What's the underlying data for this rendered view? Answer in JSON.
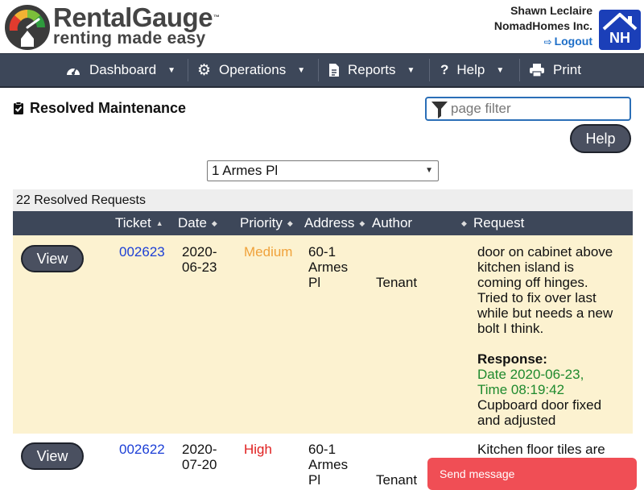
{
  "header": {
    "brand": "RentalGauge",
    "trademark": "™",
    "tagline": "renting made easy",
    "user_name": "Shawn Leclaire",
    "company": "NomadHomes Inc.",
    "logout_label": "Logout",
    "company_badge": "NH"
  },
  "nav": {
    "items": [
      {
        "label": "Dashboard",
        "icon": "dashboard-gauge-icon",
        "has_caret": true
      },
      {
        "label": "Operations",
        "icon": "gear-icon",
        "has_caret": true
      },
      {
        "label": "Reports",
        "icon": "document-icon",
        "has_caret": true
      },
      {
        "label": "Help",
        "icon": "question-icon",
        "has_caret": true
      },
      {
        "label": "Print",
        "icon": "printer-icon",
        "has_caret": false
      }
    ]
  },
  "page": {
    "title": "Resolved Maintenance",
    "filter_placeholder": "page filter",
    "help_label": "Help",
    "property_selected": "1 Armes Pl",
    "count_text": "22 Resolved Requests"
  },
  "table": {
    "columns": [
      "Ticket",
      "Date",
      "Priority",
      "Address",
      "Author",
      "Request"
    ],
    "rows": [
      {
        "view_label": "View",
        "ticket": "002623",
        "date_line1": "2020-",
        "date_line2": "06-23",
        "priority": "Medium",
        "address_line1": "60-1",
        "address_line2": "Armes",
        "address_line3": "Pl",
        "author": "Tenant",
        "request_lines": [
          "door on cabinet above",
          "kitchen island is",
          "coming off hinges.",
          "Tried to fix over last",
          "while but needs a new",
          "bolt I think."
        ],
        "response_label": "Response:",
        "response_date_line1": "Date 2020-06-23,",
        "response_date_line2": "Time 08:19:42",
        "response_lines": [
          "Cupboard door fixed",
          "and adjusted"
        ]
      },
      {
        "view_label": "View",
        "ticket": "002622",
        "date_line1": "2020-",
        "date_line2": "07-20",
        "priority": "High",
        "address_line1": "60-1",
        "address_line2": "Armes",
        "address_line3": "Pl",
        "author": "Tenant",
        "request_lines": [
          "Kitchen floor tiles are"
        ]
      }
    ]
  },
  "chat": {
    "label": "Send message"
  },
  "colors": {
    "nav_bg": "#3d4759",
    "row_highlight": "#fcf2d0",
    "link_blue": "#1c3fd6",
    "priority_medium": "#f0a23b",
    "priority_high": "#e02020",
    "response_green": "#1f8a2e",
    "chat_red": "#f04e55"
  }
}
